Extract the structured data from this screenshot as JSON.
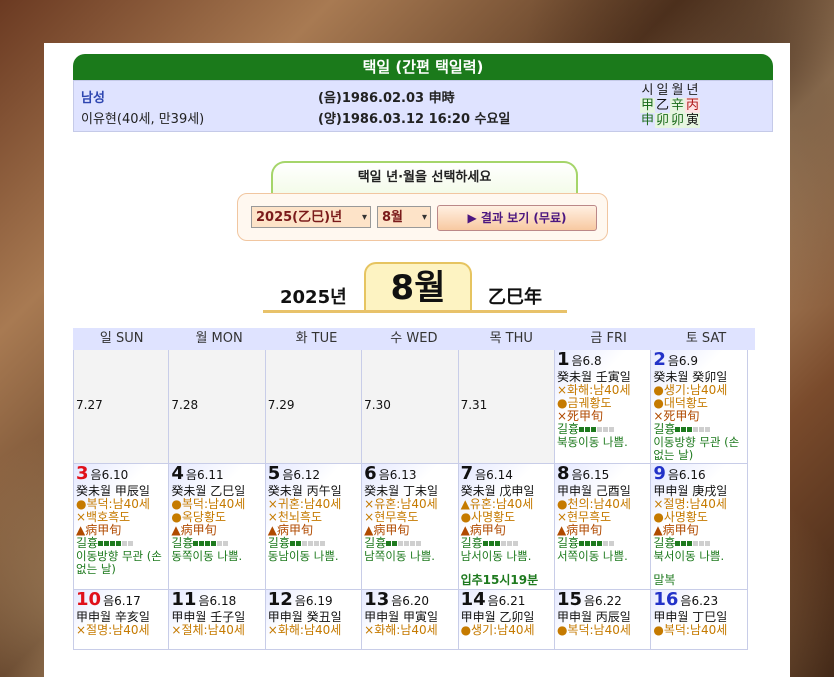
{
  "header": {
    "title": "택일 (간편 택일력)"
  },
  "person": {
    "gender": "남성",
    "name_age": "이유현(40세, 만39세)",
    "lunar": "(음)1986.02.03 申時",
    "solar": "(양)1986.03.12 16:20 수요일",
    "pillar_labels": [
      "시",
      "일",
      "월",
      "년"
    ],
    "stems": [
      "甲",
      "乙",
      "辛",
      "丙"
    ],
    "branches": [
      "申",
      "卯",
      "卯",
      "寅"
    ]
  },
  "selector": {
    "title": "택일 년·월을 선택하세요",
    "year_value": "2025(乙巳)년",
    "month_value": "8월",
    "result_button": "▶ 결과 보기 (무료)"
  },
  "month_title": {
    "year": "2025년",
    "month": "8월",
    "ganzhi": "乙巳年"
  },
  "calendar": {
    "dow": [
      "일 SUN",
      "월 MON",
      "화 TUE",
      "수 WED",
      "목 THU",
      "금 FRI",
      "토 SAT"
    ],
    "empty": [
      "7.27",
      "7.28",
      "7.29",
      "7.30",
      "7.31"
    ],
    "days": [
      {
        "d": "1",
        "lunar": "음6.8",
        "gan": "癸未월 壬寅일",
        "l1": "×화해:남40세",
        "l2": "●금궤황도",
        "l3": "×死甲旬",
        "grade": 3,
        "note": "북동이동 나쁨.",
        "extra": ""
      },
      {
        "d": "2",
        "lunar": "음6.9",
        "gan": "癸未월 癸卯일",
        "l1": "●생기:남40세",
        "l2": "●대덕황도",
        "l3": "×死甲旬",
        "grade": 3,
        "note": "이동방향 무관 (손 없는 날)",
        "extra": ""
      },
      {
        "d": "3",
        "lunar": "음6.10",
        "gan": "癸未월 甲辰일",
        "l1": "●복덕:남40세",
        "l2": "×백호흑도",
        "l3": "▲病甲旬",
        "grade": 4,
        "note": "이동방향 무관 (손 없는 날)",
        "extra": ""
      },
      {
        "d": "4",
        "lunar": "음6.11",
        "gan": "癸未월 乙巳일",
        "l1": "●복덕:남40세",
        "l2": "●옥당황도",
        "l3": "▲病甲旬",
        "grade": 4,
        "note": "동쪽이동 나쁨.",
        "extra": ""
      },
      {
        "d": "5",
        "lunar": "음6.12",
        "gan": "癸未월 丙午일",
        "l1": "×귀혼:남40세",
        "l2": "×천뇌흑도",
        "l3": "▲病甲旬",
        "grade": 2,
        "note": "동남이동 나쁨.",
        "extra": ""
      },
      {
        "d": "6",
        "lunar": "음6.13",
        "gan": "癸未월 丁未일",
        "l1": "×유혼:남40세",
        "l2": "×현무흑도",
        "l3": "▲病甲旬",
        "grade": 2,
        "note": "남쪽이동 나쁨.",
        "extra": ""
      },
      {
        "d": "7",
        "lunar": "음6.14",
        "gan": "癸未월 戊申일",
        "l1": "▲유혼:남40세",
        "l2": "●사명황도",
        "l3": "▲病甲旬",
        "grade": 3,
        "note": "남서이동 나쁨.",
        "extra": "입추15시19분"
      },
      {
        "d": "8",
        "lunar": "음6.15",
        "gan": "甲申월 己酉일",
        "l1": "●천의:남40세",
        "l2": "×현무흑도",
        "l3": "▲病甲旬",
        "grade": 4,
        "note": "서쪽이동 나쁨.",
        "extra": ""
      },
      {
        "d": "9",
        "lunar": "음6.16",
        "gan": "甲申월 庚戌일",
        "l1": "×절명:남40세",
        "l2": "●사명황도",
        "l3": "▲病甲旬",
        "grade": 3,
        "note": "북서이동 나쁨.",
        "extra": "말복"
      },
      {
        "d": "10",
        "lunar": "음6.17",
        "gan": "甲申월 辛亥일",
        "l1": "×절명:남40세",
        "l2": "",
        "l3": "",
        "grade": 0,
        "note": "",
        "extra": ""
      },
      {
        "d": "11",
        "lunar": "음6.18",
        "gan": "甲申월 壬子일",
        "l1": "×절체:남40세",
        "l2": "",
        "l3": "",
        "grade": 0,
        "note": "",
        "extra": ""
      },
      {
        "d": "12",
        "lunar": "음6.19",
        "gan": "甲申월 癸丑일",
        "l1": "×화해:남40세",
        "l2": "",
        "l3": "",
        "grade": 0,
        "note": "",
        "extra": ""
      },
      {
        "d": "13",
        "lunar": "음6.20",
        "gan": "甲申월 甲寅일",
        "l1": "×화해:남40세",
        "l2": "",
        "l3": "",
        "grade": 0,
        "note": "",
        "extra": ""
      },
      {
        "d": "14",
        "lunar": "음6.21",
        "gan": "甲申월 乙卯일",
        "l1": "●생기:남40세",
        "l2": "",
        "l3": "",
        "grade": 0,
        "note": "",
        "extra": ""
      },
      {
        "d": "15",
        "lunar": "음6.22",
        "gan": "甲申월 丙辰일",
        "l1": "●복덕:남40세",
        "l2": "",
        "l3": "",
        "grade": 0,
        "note": "",
        "extra": ""
      },
      {
        "d": "16",
        "lunar": "음6.23",
        "gan": "甲申월 丁巳일",
        "l1": "●복덕:남40세",
        "l2": "",
        "l3": "",
        "grade": 0,
        "note": "",
        "extra": ""
      }
    ],
    "grade_label": "길흉"
  }
}
